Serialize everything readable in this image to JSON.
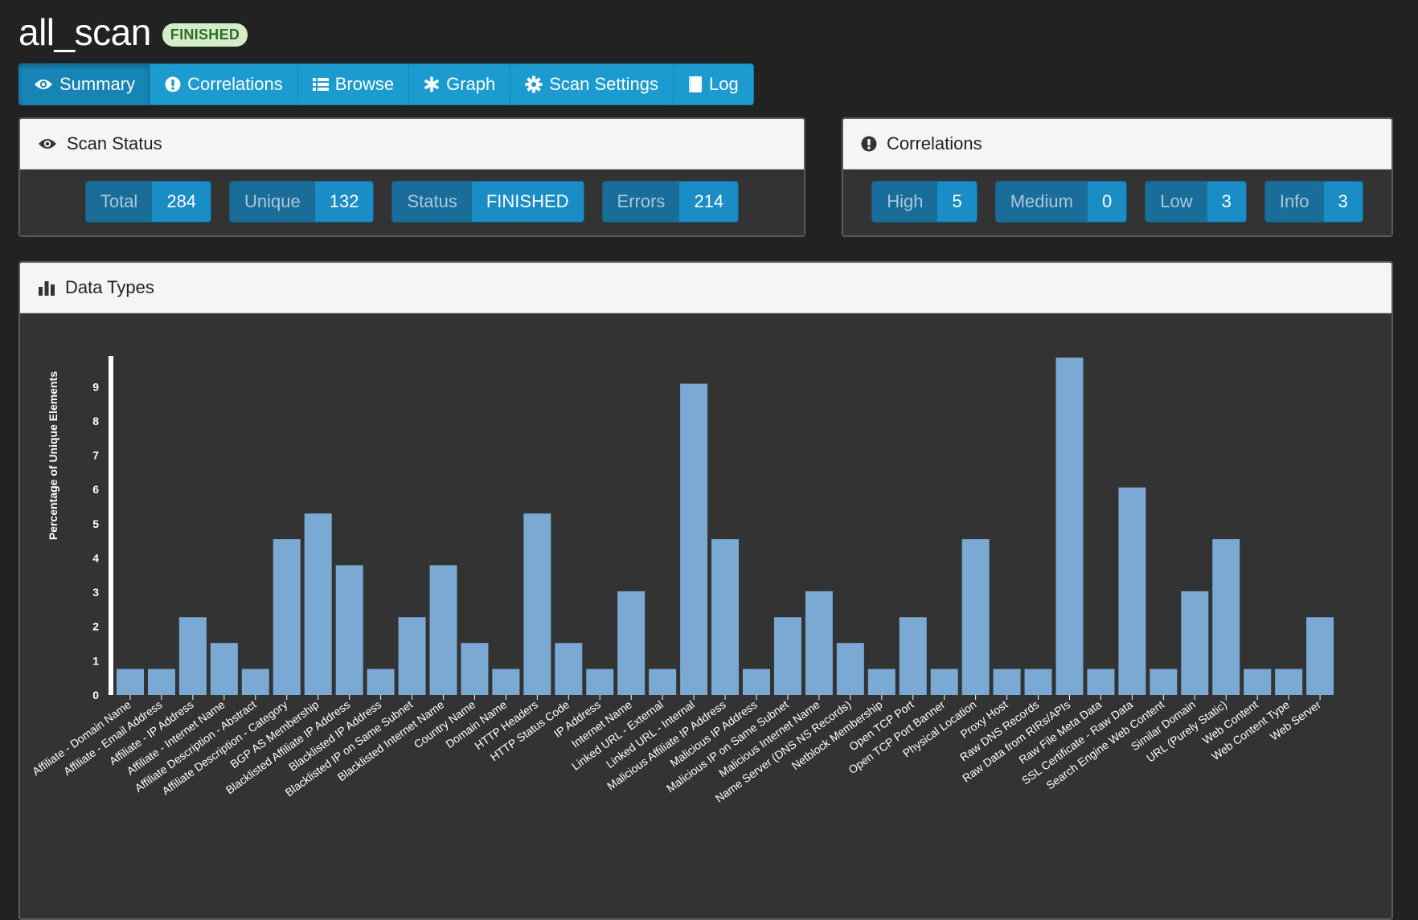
{
  "scan": {
    "name": "all_scan",
    "badge": "FINISHED"
  },
  "tabs": [
    {
      "label": "Summary",
      "icon": "eye-icon",
      "active": true
    },
    {
      "label": "Correlations",
      "icon": "exclamation-circle-icon"
    },
    {
      "label": "Browse",
      "icon": "list-icon"
    },
    {
      "label": "Graph",
      "icon": "asterisk-icon"
    },
    {
      "label": "Scan Settings",
      "icon": "gear-icon"
    },
    {
      "label": "Log",
      "icon": "document-icon"
    }
  ],
  "scan_status": {
    "title": "Scan Status",
    "stats": [
      {
        "label": "Total",
        "value": "284"
      },
      {
        "label": "Unique",
        "value": "132"
      },
      {
        "label": "Status",
        "value": "FINISHED"
      },
      {
        "label": "Errors",
        "value": "214"
      }
    ]
  },
  "correlations": {
    "title": "Correlations",
    "stats": [
      {
        "label": "High",
        "value": "5"
      },
      {
        "label": "Medium",
        "value": "0"
      },
      {
        "label": "Low",
        "value": "3"
      },
      {
        "label": "Info",
        "value": "3"
      }
    ]
  },
  "data_types": {
    "title": "Data Types"
  },
  "colors": {
    "bar": "#7aa9d3",
    "tab": "#1b9bd0",
    "badge_bg": "#d4ecc8",
    "badge_text": "#2f6e2a"
  },
  "chart_data": {
    "type": "bar",
    "ylabel": "Percentage of Unique Elements",
    "xlabel": "",
    "ylim": [
      0,
      9.9
    ],
    "yticks": [
      0,
      1,
      2,
      3,
      4,
      5,
      6,
      7,
      8,
      9
    ],
    "categories": [
      "Affiliate - Domain Name",
      "Affiliate - Email Address",
      "Affiliate - IP Address",
      "Affiliate - Internet Name",
      "Affiliate Description - Abstract",
      "Affiliate Description - Category",
      "BGP AS Membership",
      "Blacklisted Affiliate IP Address",
      "Blacklisted IP Address",
      "Blacklisted IP on Same Subnet",
      "Blacklisted Internet Name",
      "Country Name",
      "Domain Name",
      "HTTP Headers",
      "HTTP Status Code",
      "IP Address",
      "Internet Name",
      "Linked URL - External",
      "Linked URL - Internal",
      "Malicious Affiliate IP Address",
      "Malicious IP Address",
      "Malicious IP on Same Subnet",
      "Malicious Internet Name",
      "Name Server (DNS NS Records)",
      "Netblock Membership",
      "Open TCP Port",
      "Open TCP Port Banner",
      "Physical Location",
      "Proxy Host",
      "Raw DNS Records",
      "Raw Data from RIRs/APIs",
      "Raw File Meta Data",
      "SSL Certificate - Raw Data",
      "Search Engine Web Content",
      "Similar Domain",
      "URL (Purely Static)",
      "Web Content",
      "Web Content Type",
      "Web Server"
    ],
    "values": [
      0.76,
      0.76,
      2.27,
      1.52,
      0.76,
      4.55,
      5.3,
      3.79,
      0.76,
      2.27,
      3.79,
      1.52,
      0.76,
      5.3,
      1.52,
      0.76,
      3.03,
      0.76,
      9.09,
      4.55,
      0.76,
      2.27,
      3.03,
      1.52,
      0.76,
      2.27,
      0.76,
      4.55,
      0.76,
      0.76,
      9.85,
      0.76,
      6.06,
      0.76,
      3.03,
      4.55,
      0.76,
      0.76,
      2.27
    ],
    "grid": false,
    "legend": "none"
  }
}
